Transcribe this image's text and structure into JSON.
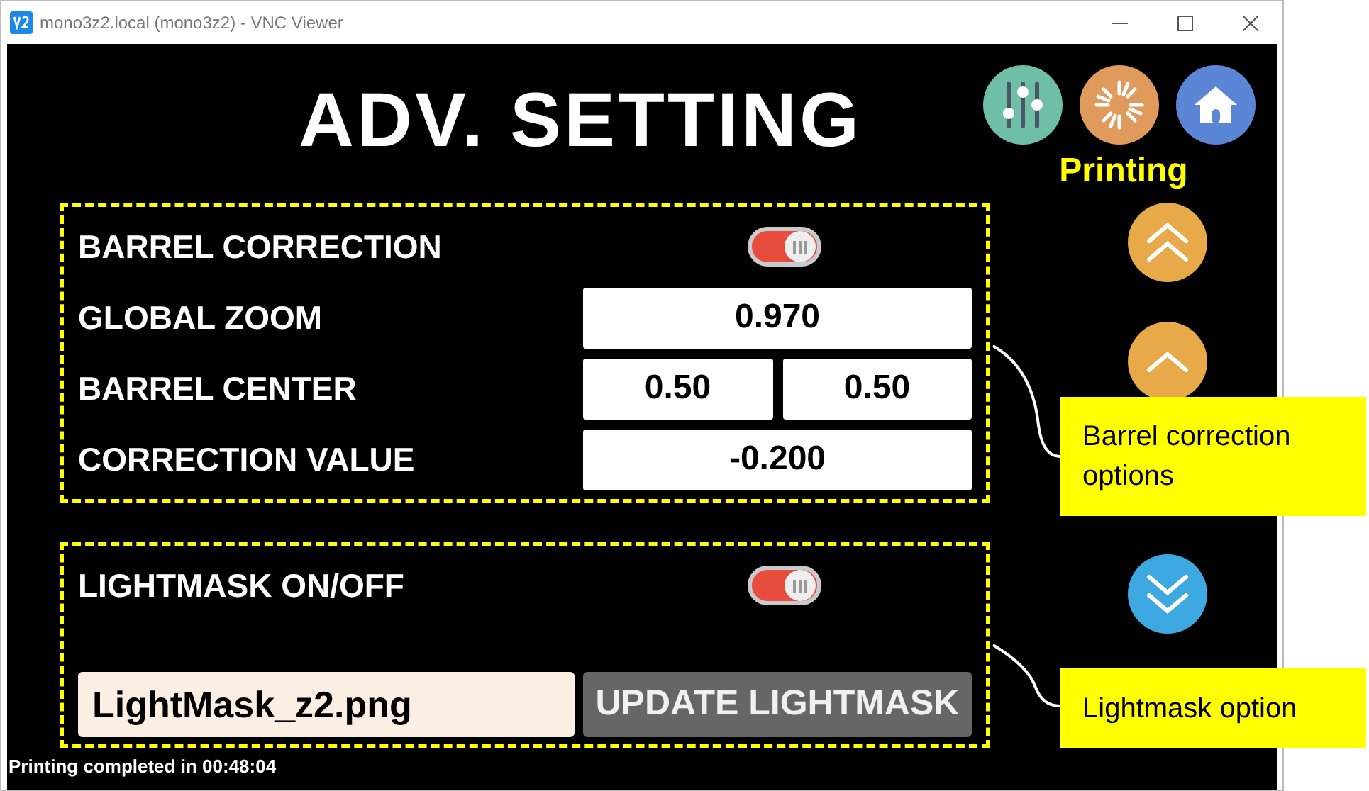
{
  "window": {
    "title": "mono3z2.local (mono3z2) - VNC Viewer"
  },
  "header": {
    "title": "ADV. SETTING",
    "status": "Printing"
  },
  "sections": [
    {
      "rows": [
        {
          "kind": "toggle",
          "label": "BARREL CORRECTION",
          "on": true
        },
        {
          "kind": "fields",
          "label": "GLOBAL ZOOM",
          "values": [
            "0.970"
          ]
        },
        {
          "kind": "fields",
          "label": "BARREL CENTER",
          "values": [
            "0.50",
            "0.50"
          ]
        },
        {
          "kind": "fields",
          "label": "CORRECTION VALUE",
          "values": [
            "-0.200"
          ]
        }
      ]
    },
    {
      "rows": [
        {
          "kind": "toggle",
          "label": "LIGHTMASK ON/OFF",
          "on": true
        },
        {
          "kind": "file",
          "value": "LightMask_z2.png",
          "button": "UPDATE LIGHTMASK"
        }
      ]
    }
  ],
  "status_bar": "Printing completed in 00:48:04",
  "callouts": [
    {
      "text": "Barrel correction options"
    },
    {
      "text": "Lightmask option"
    }
  ]
}
